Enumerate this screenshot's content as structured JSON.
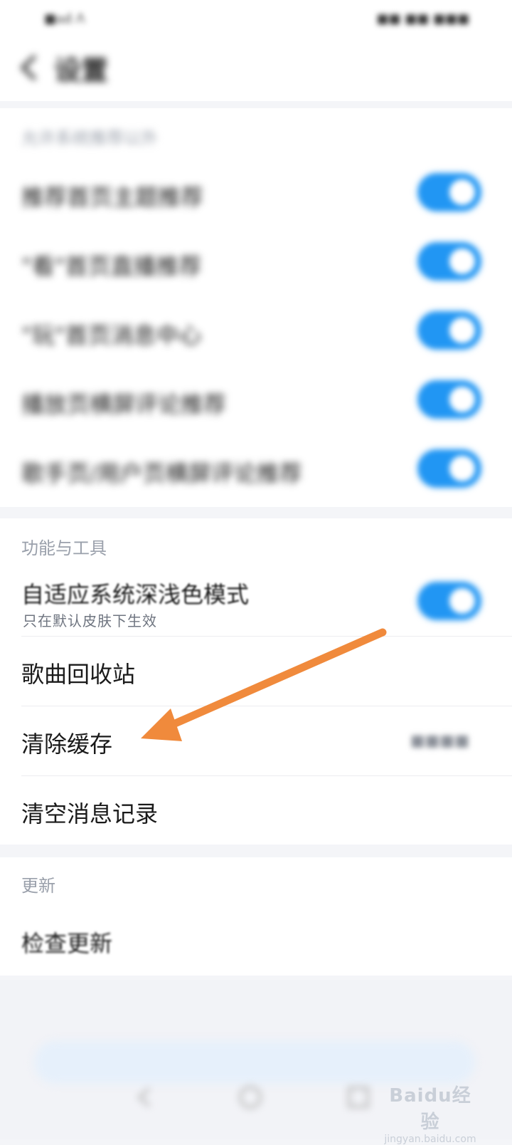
{
  "status_bar": {
    "left": "■ad ᐱ",
    "right": "■■ ■■ ■■■"
  },
  "header": {
    "title": "设置"
  },
  "section_personal": {
    "header": "允许系统推荐以外",
    "items": [
      {
        "label": "推荐首页主题推荐",
        "on": true
      },
      {
        "label": "\"看\"首页直播推荐",
        "on": true
      },
      {
        "label": "\"玩\"首页消息中心",
        "on": true
      },
      {
        "label": "播放页横屏评论推荐",
        "on": true
      },
      {
        "label": "歌手页/用户页横屏评论推荐",
        "on": true
      }
    ]
  },
  "section_tools": {
    "header": "功能与工具",
    "items": [
      {
        "label": "自适应系统深浅色模式",
        "sub": "只在默认皮肤下生效",
        "on": true
      },
      {
        "label": "歌曲回收站"
      },
      {
        "label": "清除缓存",
        "value": "■■■■"
      },
      {
        "label": "清空消息记录"
      }
    ]
  },
  "section_update": {
    "header": "更新",
    "items": [
      {
        "label": "检查更新"
      }
    ]
  },
  "colors": {
    "toggle_on": "#2196f3",
    "arrow": "#f08a3c"
  },
  "watermark": {
    "logo": "Baidu经验",
    "url": "jingyan.baidu.com"
  }
}
